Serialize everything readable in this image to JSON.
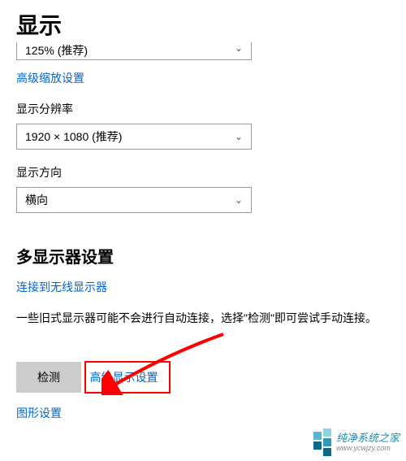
{
  "title": "显示",
  "dropdowns": {
    "scale": {
      "value": "125% (推荐)"
    },
    "resolution": {
      "label": "显示分辨率",
      "value": "1920 × 1080 (推荐)"
    },
    "orientation": {
      "label": "显示方向",
      "value": "横向"
    }
  },
  "links": {
    "advanced_scaling": "高级缩放设置",
    "connect_wireless": "连接到无线显示器",
    "advanced_display": "高级显示设置",
    "graphics": "图形设置"
  },
  "multi_monitor": {
    "heading": "多显示器设置",
    "info": "一些旧式显示器可能不会进行自动连接，选择\"检测\"即可尝试手动连接。",
    "detect_button": "检测"
  },
  "watermark": {
    "brand": "纯净系统之家",
    "url": "www.ycwjzy.com"
  }
}
